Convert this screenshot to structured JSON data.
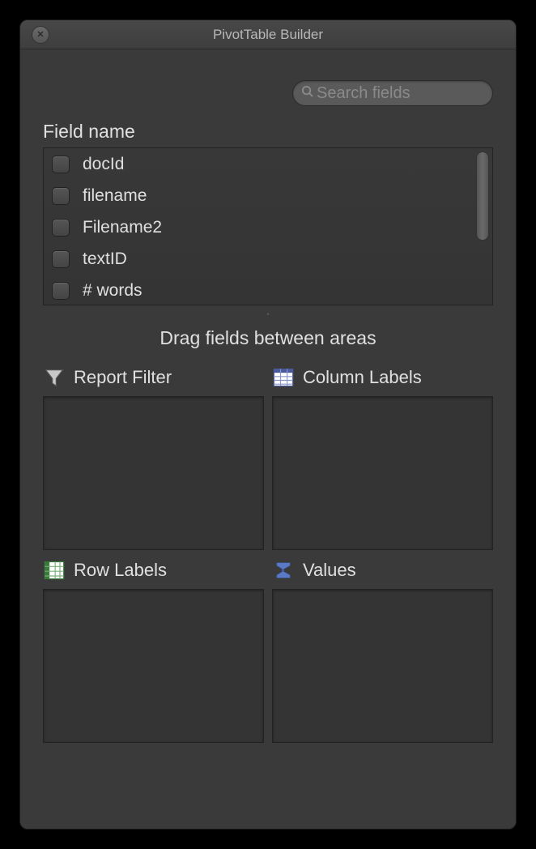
{
  "window": {
    "title": "PivotTable Builder"
  },
  "search": {
    "placeholder": "Search fields"
  },
  "fieldSection": {
    "header": "Field name",
    "fields": [
      {
        "label": "docId"
      },
      {
        "label": "filename"
      },
      {
        "label": "Filename2"
      },
      {
        "label": "textID"
      },
      {
        "label": "# words"
      }
    ]
  },
  "instruction": "Drag fields between areas",
  "areas": {
    "reportFilter": {
      "label": "Report Filter"
    },
    "columnLabels": {
      "label": "Column Labels"
    },
    "rowLabels": {
      "label": "Row Labels"
    },
    "values": {
      "label": "Values"
    }
  }
}
